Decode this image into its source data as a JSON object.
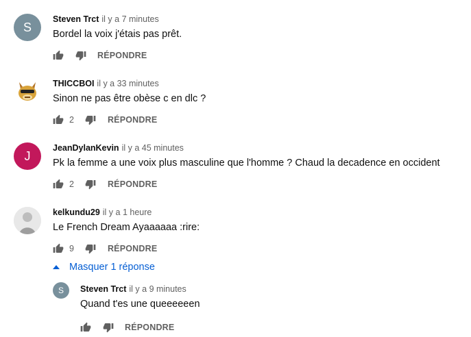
{
  "reply_label": "RÉPONDRE",
  "comments": [
    {
      "author": "Steven Trct",
      "time": "il y a 7 minutes",
      "text": "Bordel la voix j'étais pas prêt.",
      "likes": "",
      "avatar_letter": "S",
      "avatar_color": "#78909c"
    },
    {
      "author": "THICCBOI",
      "time": "il y a 33 minutes",
      "text": "Sinon ne pas être obèse c en dlc ?",
      "likes": "2",
      "avatar_letter": "",
      "avatar_color": "#d8a33a"
    },
    {
      "author": "JeanDylanKevin",
      "time": "il y a 45 minutes",
      "text": "Pk la femme a une voix plus masculine que l'homme ? Chaud la decadence en occident",
      "likes": "2",
      "avatar_letter": "J",
      "avatar_color": "#c2185b"
    },
    {
      "author": "kelkundu29",
      "time": "il y a 1 heure",
      "text": "Le French Dream Ayaaaaaa :rire:",
      "likes": "9",
      "avatar_letter": "",
      "avatar_color": "#d9d9d9"
    }
  ],
  "hide_replies_label": "Masquer 1 réponse",
  "reply": {
    "author": "Steven Trct",
    "time": "il y a 9 minutes",
    "text": "Quand t'es une queeeeeen",
    "likes": "",
    "avatar_letter": "S",
    "avatar_color": "#78909c"
  },
  "colors": {
    "link": "#065fd4",
    "secondary_text": "#606060"
  }
}
